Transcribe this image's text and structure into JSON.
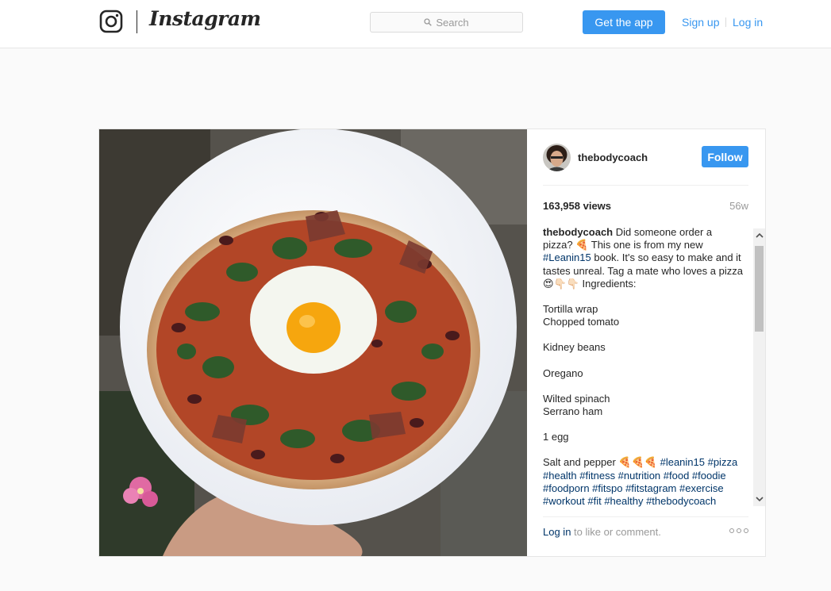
{
  "header": {
    "wordmark": "Instagram",
    "search_placeholder": "Search",
    "get_app_label": "Get the app",
    "signup_label": "Sign up",
    "login_label": "Log in",
    "accent_color": "#3897f0"
  },
  "post": {
    "username": "thebodycoach",
    "follow_label": "Follow",
    "views": "163,958 views",
    "age": "56w",
    "caption": {
      "intro": "Did someone order a pizza? 🍕 This one is from my new",
      "intro_tag": "#Leanin15",
      "intro_rest": "book. It's so easy to make and it tastes unreal. Tag a mate who loves a pizza 😍👇🏻👇🏻 Ingredients:",
      "ingredients": [
        "Tortilla wrap",
        "Chopped tomato",
        "Kidney beans",
        "Oregano",
        "Wilted spinach",
        "Serrano ham",
        "1 egg"
      ],
      "final_text": "Salt and pepper 🍕🍕🍕",
      "hashtags": "#leanin15 #pizza #health #fitness #nutrition #food #foodie #foodporn #fitspo #fitstagram #exercise #workout #fit #healthy #thebodycoach"
    },
    "login_link": "Log in",
    "login_suffix": "to like or comment.",
    "more_icon": "ellipsis-icon"
  }
}
